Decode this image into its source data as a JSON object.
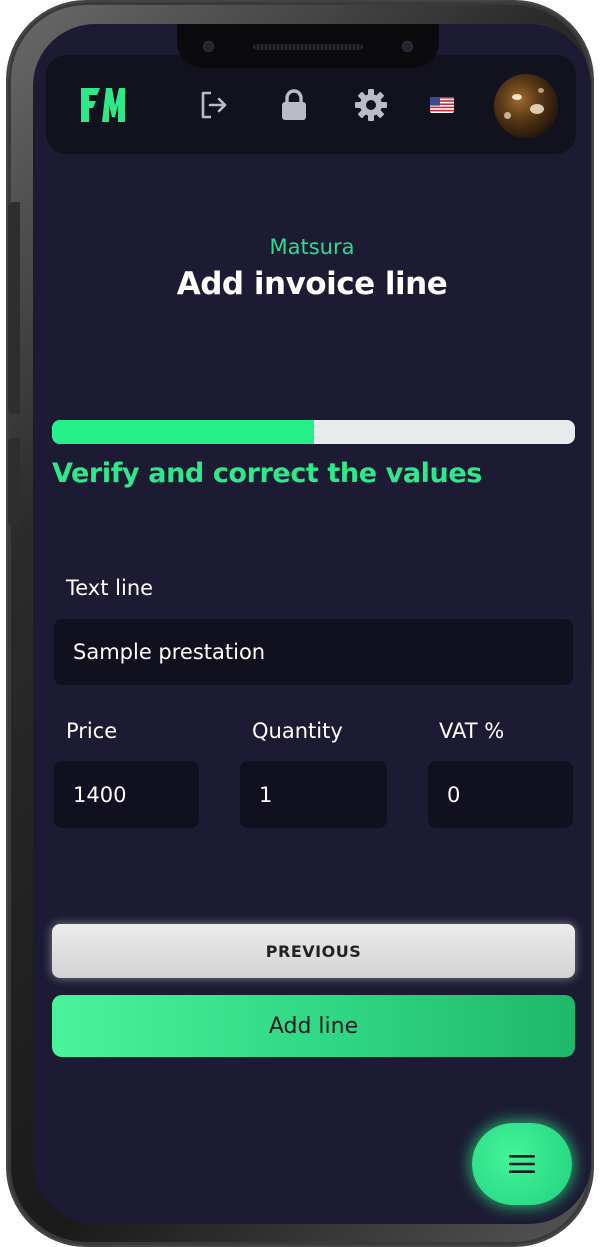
{
  "header": {
    "logo_text": "FM",
    "icons": [
      "logout-icon",
      "lock-icon",
      "gear-icon",
      "us-flag-icon",
      "avatar"
    ]
  },
  "page": {
    "subtitle": "Matsura",
    "title": "Add invoice line"
  },
  "progress": {
    "value_fraction": 0.5,
    "step_label": "Verify and correct the values"
  },
  "form": {
    "text_line": {
      "label": "Text line",
      "value": "Sample prestation"
    },
    "price": {
      "label": "Price",
      "value": "1400"
    },
    "quantity": {
      "label": "Quantity",
      "value": "1"
    },
    "vat": {
      "label": "VAT %",
      "value": "0"
    }
  },
  "buttons": {
    "previous": "PREVIOUS",
    "add_line": "Add line"
  },
  "fab": {
    "icon": "menu-icon"
  },
  "colors": {
    "background": "#1c1b33",
    "accent": "#25f08a",
    "input_bg": "#11101f",
    "header_bg": "#12121f"
  }
}
